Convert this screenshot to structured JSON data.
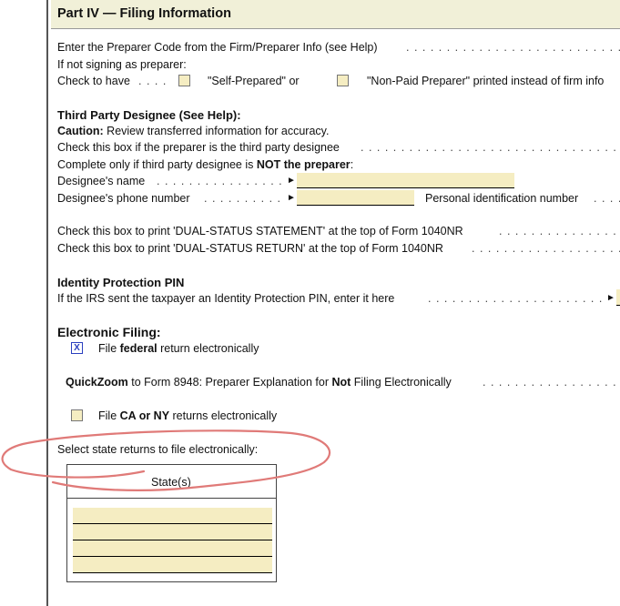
{
  "header": {
    "title": "Part IV — Filing Information"
  },
  "preparer": {
    "code_label": "Enter the Preparer Code from the Firm/Preparer Info (see Help)",
    "not_signing": "If not signing as preparer:",
    "check_to_have": "Check to have",
    "self_prepared": "\"Self-Prepared\" or",
    "non_paid": "\"Non-Paid Preparer\" printed instead of firm info"
  },
  "third_party": {
    "title": "Third Party Designee (See Help):",
    "caution_label": "Caution:",
    "caution_text": " Review transferred information for accuracy.",
    "check_line": "Check this box if the preparer is the third party designee",
    "complete_prefix": "Complete only if third party designee is ",
    "complete_bold": "NOT the preparer",
    "complete_suffix": ":",
    "name_label": "Designee's name",
    "phone_label": "Designee's phone number",
    "pin_label": "Personal identification number"
  },
  "dual_status": {
    "statement": "Check this box to print 'DUAL-STATUS STATEMENT' at the top of Form 1040NR",
    "return": "Check this box to print 'DUAL-STATUS RETURN' at the top of Form 1040NR"
  },
  "ip_pin": {
    "title": "Identity Protection PIN",
    "text": "If the IRS sent the taxpayer an Identity Protection PIN, enter it here"
  },
  "efile": {
    "title": "Electronic Filing:",
    "federal_checkbox_mark": "X",
    "federal_pre": "File ",
    "federal_bold": "federal",
    "federal_post": " return electronically",
    "qz_bold": "QuickZoom",
    "qz_mid": " to Form 8948: Preparer Explanation for ",
    "qz_not": "Not",
    "qz_end": " Filing Electronically",
    "state_pre": "File ",
    "state_bold": "CA or NY",
    "state_post": " returns electronically",
    "select_states": "Select state returns to file electronically:",
    "table_header": "State(s)",
    "state_rows": [
      "",
      "",
      "",
      ""
    ]
  },
  "symbols": {
    "arrow": "►"
  },
  "colors": {
    "field": "#f5edc2",
    "header": "#f1f0d8",
    "annotation": "#e07a78"
  }
}
